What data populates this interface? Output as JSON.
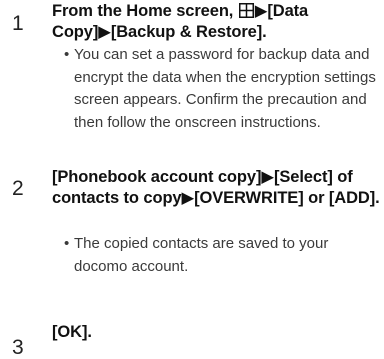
{
  "steps": [
    {
      "number": "1",
      "title_prefix": "From the Home screen,",
      "title_suffix": "▶[Data Copy]▶[Backup & Restore].",
      "note": "You can set a password for backup data and encrypt the data when the encryption settings screen appears. Confirm the precaution and then follow the onscreen instructions."
    },
    {
      "number": "2",
      "title": "[Phonebook account copy]▶[Select] of contacts to copy▶[OVERWRITE] or [ADD].",
      "note": "The copied contacts are saved to your docomo account."
    },
    {
      "number": "3",
      "title": "[OK]."
    }
  ],
  "bullet": "•",
  "icons": {
    "app_grid": "app-grid-icon"
  }
}
